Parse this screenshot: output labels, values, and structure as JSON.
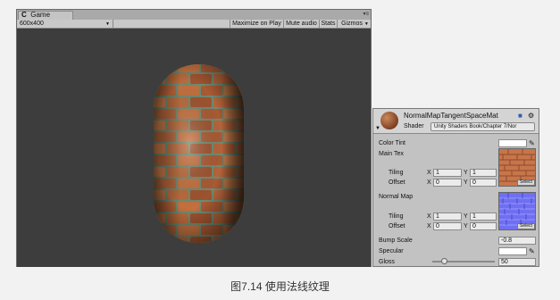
{
  "game": {
    "tab_title": "Game",
    "tab_icon": "unity-logo-icon",
    "menu_icon": "window-menu-icon",
    "resolution": "600x400",
    "toolbar": {
      "maximize": "Maximize on Play",
      "mute": "Mute audio",
      "stats": "Stats",
      "gizmos": "Gizmos"
    }
  },
  "inspector": {
    "material_name": "NormalMapTangentSpaceMat",
    "shader_label": "Shader",
    "shader_value": "Unity Shaders Book/Chapter 7/Nor",
    "properties": {
      "color_tint": "Color Tint",
      "main_tex": "Main Tex",
      "tiling": "Tiling",
      "offset": "Offset",
      "normal_map": "Normal Map",
      "bump_scale": "Bump Scale",
      "specular": "Specular",
      "gloss": "Gloss"
    },
    "axis_x": "X",
    "axis_y": "Y",
    "main_tex_values": {
      "tiling_x": "1",
      "tiling_y": "1",
      "offset_x": "0",
      "offset_y": "0"
    },
    "normal_map_values": {
      "tiling_x": "1",
      "tiling_y": "1",
      "offset_x": "0",
      "offset_y": "0"
    },
    "bump_scale_value": "-0.8",
    "gloss_value": "50",
    "gloss_fraction": 0.18,
    "select_label": "Select",
    "colors": {
      "color_tint": "#ffffff",
      "specular": "#ffffff"
    }
  },
  "caption": "图7.14  使用法线纹理"
}
